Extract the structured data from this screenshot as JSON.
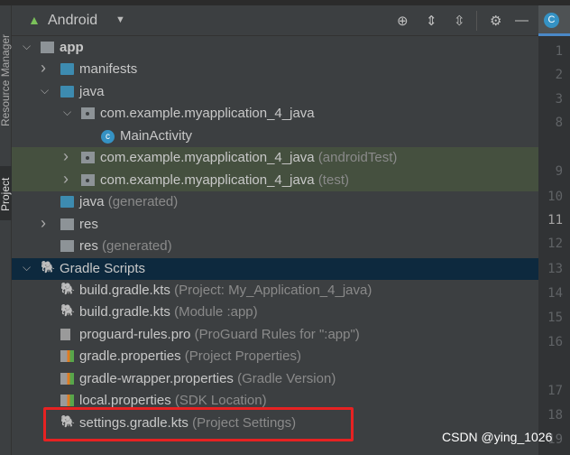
{
  "side_strip": {
    "tabs": [
      {
        "label": "Resource Manager"
      },
      {
        "label": "Project",
        "selected": true
      }
    ]
  },
  "header": {
    "view_mode": "Android",
    "icons": [
      "locate-icon",
      "expand-all-icon",
      "collapse-all-icon",
      "gear-icon",
      "minimize-icon"
    ]
  },
  "tree": [
    {
      "label": "app",
      "hint": "",
      "level": 0,
      "arrow": "down",
      "icon": "module-folder",
      "bold": true
    },
    {
      "label": "manifests",
      "hint": "",
      "level": 1,
      "arrow": "right",
      "icon": "folder"
    },
    {
      "label": "java",
      "hint": "",
      "level": 1,
      "arrow": "down",
      "icon": "folder"
    },
    {
      "label": "com.example.myapplication_4_java",
      "hint": "",
      "level": 2,
      "arrow": "down",
      "icon": "package"
    },
    {
      "label": "MainActivity",
      "hint": "",
      "level": 3,
      "arrow": "",
      "icon": "class"
    },
    {
      "label": "com.example.myapplication_4_java",
      "hint": "(androidTest)",
      "level": 2,
      "arrow": "right",
      "icon": "package",
      "highlight": true
    },
    {
      "label": "com.example.myapplication_4_java",
      "hint": "(test)",
      "level": 2,
      "arrow": "right",
      "icon": "package",
      "highlight": true
    },
    {
      "label": "java",
      "hint": "(generated)",
      "level": 1,
      "arrow": "",
      "icon": "generated-folder"
    },
    {
      "label": "res",
      "hint": "",
      "level": 1,
      "arrow": "right",
      "icon": "res-folder"
    },
    {
      "label": "res",
      "hint": "(generated)",
      "level": 1,
      "arrow": "",
      "icon": "res-folder"
    },
    {
      "label": "Gradle Scripts",
      "hint": "",
      "level": 0,
      "arrow": "down",
      "icon": "gradle",
      "selected": true
    },
    {
      "label": "build.gradle.kts",
      "hint": "(Project: My_Application_4_java)",
      "level": 1,
      "arrow": "",
      "icon": "gradle-kts"
    },
    {
      "label": "build.gradle.kts",
      "hint": "(Module :app)",
      "level": 1,
      "arrow": "",
      "icon": "gradle-kts"
    },
    {
      "label": "proguard-rules.pro",
      "hint": "(ProGuard Rules for \":app\")",
      "level": 1,
      "arrow": "",
      "icon": "file"
    },
    {
      "label": "gradle.properties",
      "hint": "(Project Properties)",
      "level": 1,
      "arrow": "",
      "icon": "properties"
    },
    {
      "label": "gradle-wrapper.properties",
      "hint": "(Gradle Version)",
      "level": 1,
      "arrow": "",
      "icon": "properties"
    },
    {
      "label": "local.properties",
      "hint": "(SDK Location)",
      "level": 1,
      "arrow": "",
      "icon": "properties"
    },
    {
      "label": "settings.gradle.kts",
      "hint": "(Project Settings)",
      "level": 1,
      "arrow": "",
      "icon": "gradle-kts",
      "annotated": true
    }
  ],
  "editor": {
    "tab_icon": "C",
    "line_numbers": [
      "1",
      "2",
      "3",
      "8",
      "9",
      "10",
      "11",
      "12",
      "13",
      "14",
      "15",
      "16",
      "17",
      "18",
      "19"
    ],
    "current_line": "11"
  },
  "annotation": {
    "color": "#e62222"
  },
  "watermark": "CSDN @ying_1026",
  "colors": {
    "selection": "#0d293e",
    "test_highlight": "#45503f",
    "accent": "#4a88c7"
  }
}
